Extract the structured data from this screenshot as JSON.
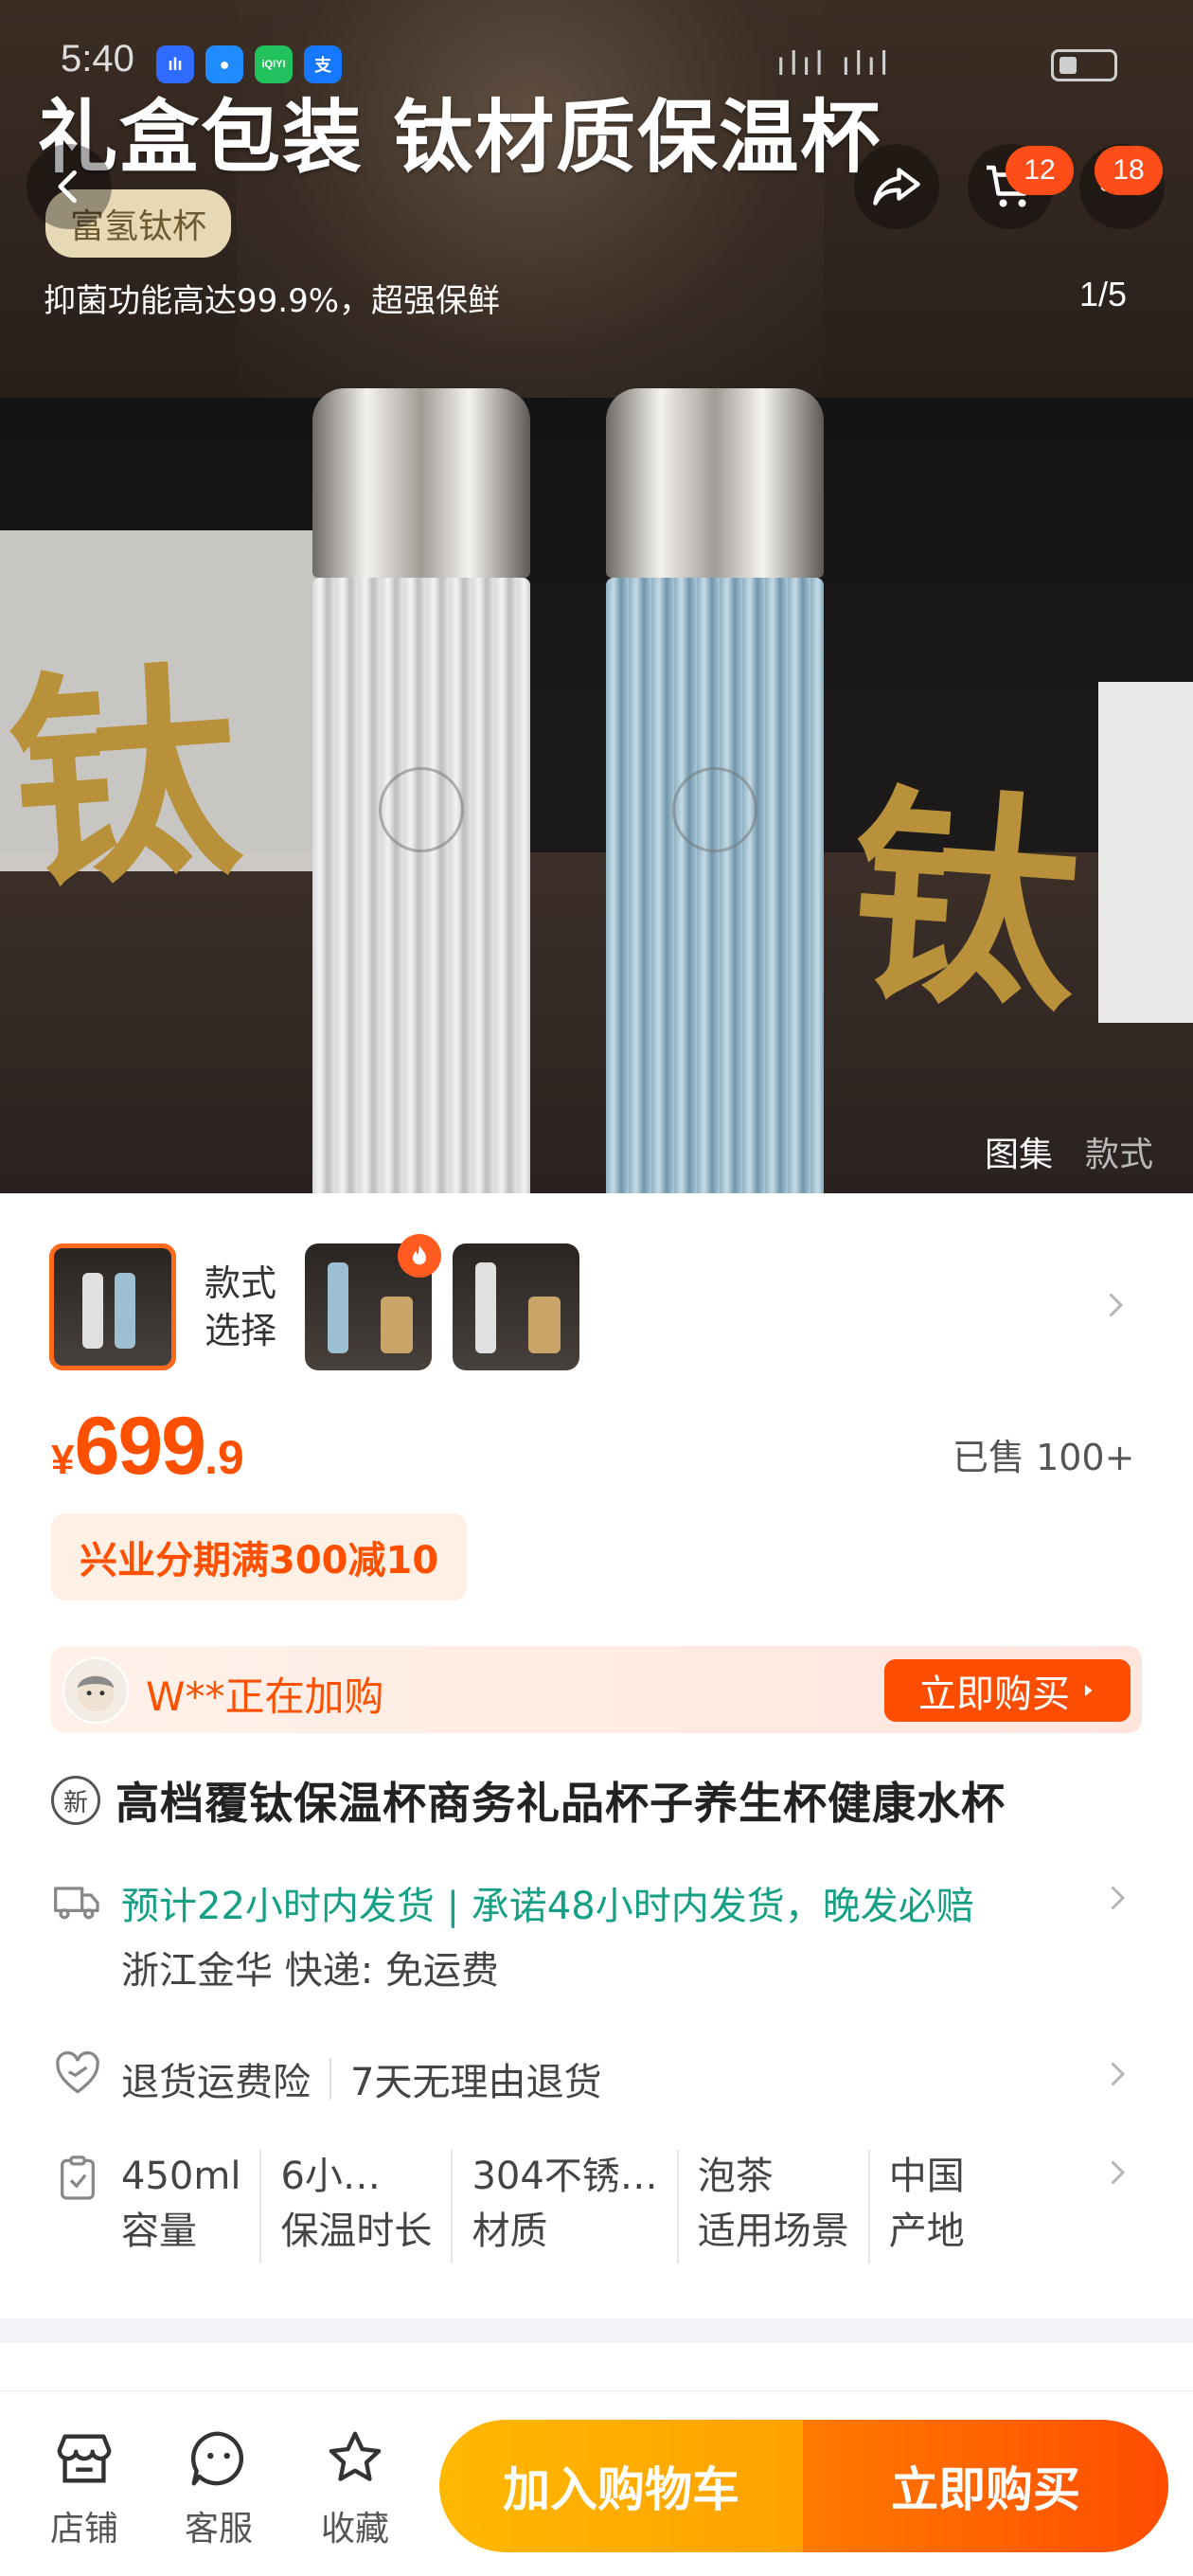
{
  "status_bar": {
    "time": "5:40",
    "apps": [
      {
        "name": "voice-app-icon",
        "glyph": "ılı",
        "color": "#2f6bff"
      },
      {
        "name": "message-app-icon",
        "glyph": "●",
        "color": "#1e8cff"
      },
      {
        "name": "iqiyi-app-icon",
        "glyph": "iQIYI",
        "color": "#21c25e"
      },
      {
        "name": "alipay-app-icon",
        "glyph": "支",
        "color": "#1677ff"
      }
    ],
    "signal": "ılıl ılıl"
  },
  "hero": {
    "title": "礼盒包装 钛材质保温杯",
    "tag": "富氢钛杯",
    "subtitle": "抑菌功能高达99.9%，超强保鲜",
    "counter": "1/5",
    "glyph": "钛",
    "cart_badge": "12",
    "more_badge": "18",
    "tabs": {
      "gallery": "图集",
      "styles": "款式"
    }
  },
  "styles": {
    "label": "款式\n选择"
  },
  "price": {
    "currency": "¥",
    "integer": "699",
    "decimal": ".9",
    "sold": "已售 100+"
  },
  "promo": {
    "text": "兴业分期满300减10"
  },
  "buying": {
    "text": "W**正在加购",
    "button": "立即购买"
  },
  "product": {
    "new_badge": "新",
    "title": "高档覆钛保温杯商务礼品杯子养生杯健康水杯"
  },
  "shipping": {
    "line1": "预计22小时内发货 | 承诺48小时内发货，晚发必赔",
    "line2": "浙江金华  快递:  免运费"
  },
  "service": {
    "item1": "退货运费险",
    "item2": "7天无理由退货"
  },
  "specs": [
    {
      "value": "450ml",
      "key": "容量"
    },
    {
      "value": "6小…",
      "key": "保温时长"
    },
    {
      "value": "304不锈…",
      "key": "材质"
    },
    {
      "value": "泡茶",
      "key": "适用场景"
    },
    {
      "value": "中国",
      "key": "产地"
    }
  ],
  "bottom_bar": {
    "store": "店铺",
    "service": "客服",
    "favorite": "收藏",
    "add_to_cart": "加入购物车",
    "buy_now": "立即购买"
  },
  "colors": {
    "accent": "#ff5000",
    "shipping_green": "#16a085",
    "cart_yellow": "#ffb800",
    "buy_orange": "#ff4d00"
  }
}
